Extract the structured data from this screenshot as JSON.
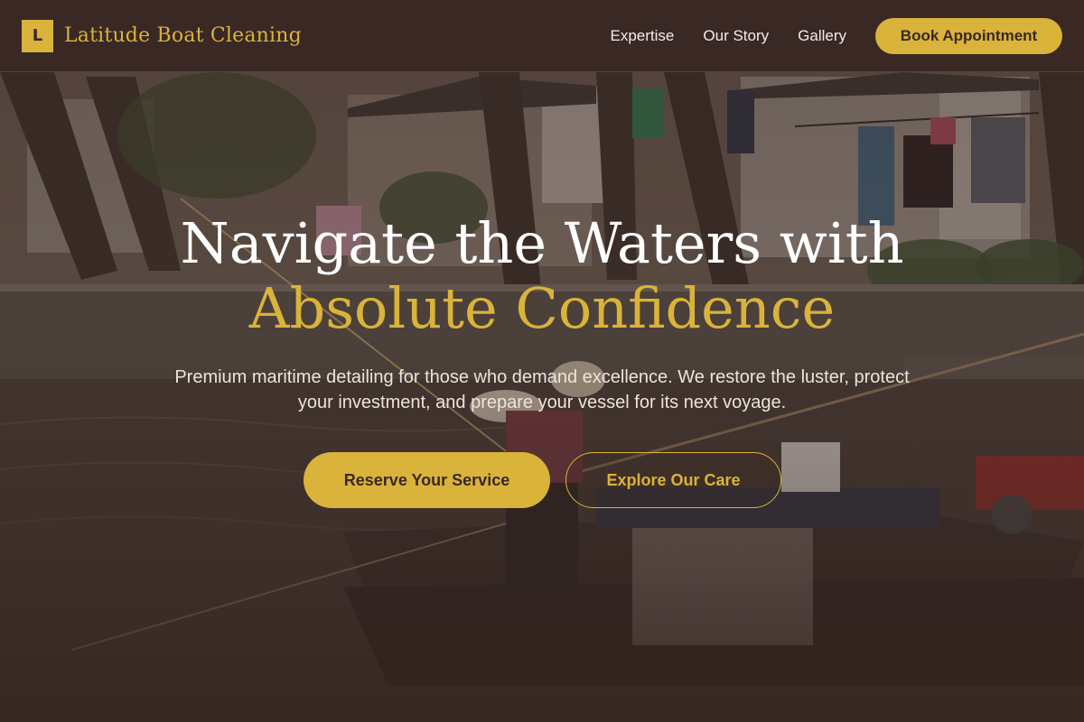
{
  "brand": {
    "mark": "L",
    "name": "Latitude Boat Cleaning"
  },
  "nav": {
    "links": [
      "Expertise",
      "Our Story",
      "Gallery"
    ],
    "cta": "Book Appointment"
  },
  "hero": {
    "title_line1": "Navigate the Waters with",
    "title_line2": "Absolute Confidence",
    "subtitle": "Premium maritime detailing for those who demand excellence. We restore the luster, protect your investment, and prepare your vessel for its next voyage.",
    "primary_cta": "Reserve Your Service",
    "secondary_cta": "Explore Our Care"
  },
  "colors": {
    "accent": "#d9b33a",
    "header_bg": "#3a2824",
    "text_light": "#ffffff"
  }
}
